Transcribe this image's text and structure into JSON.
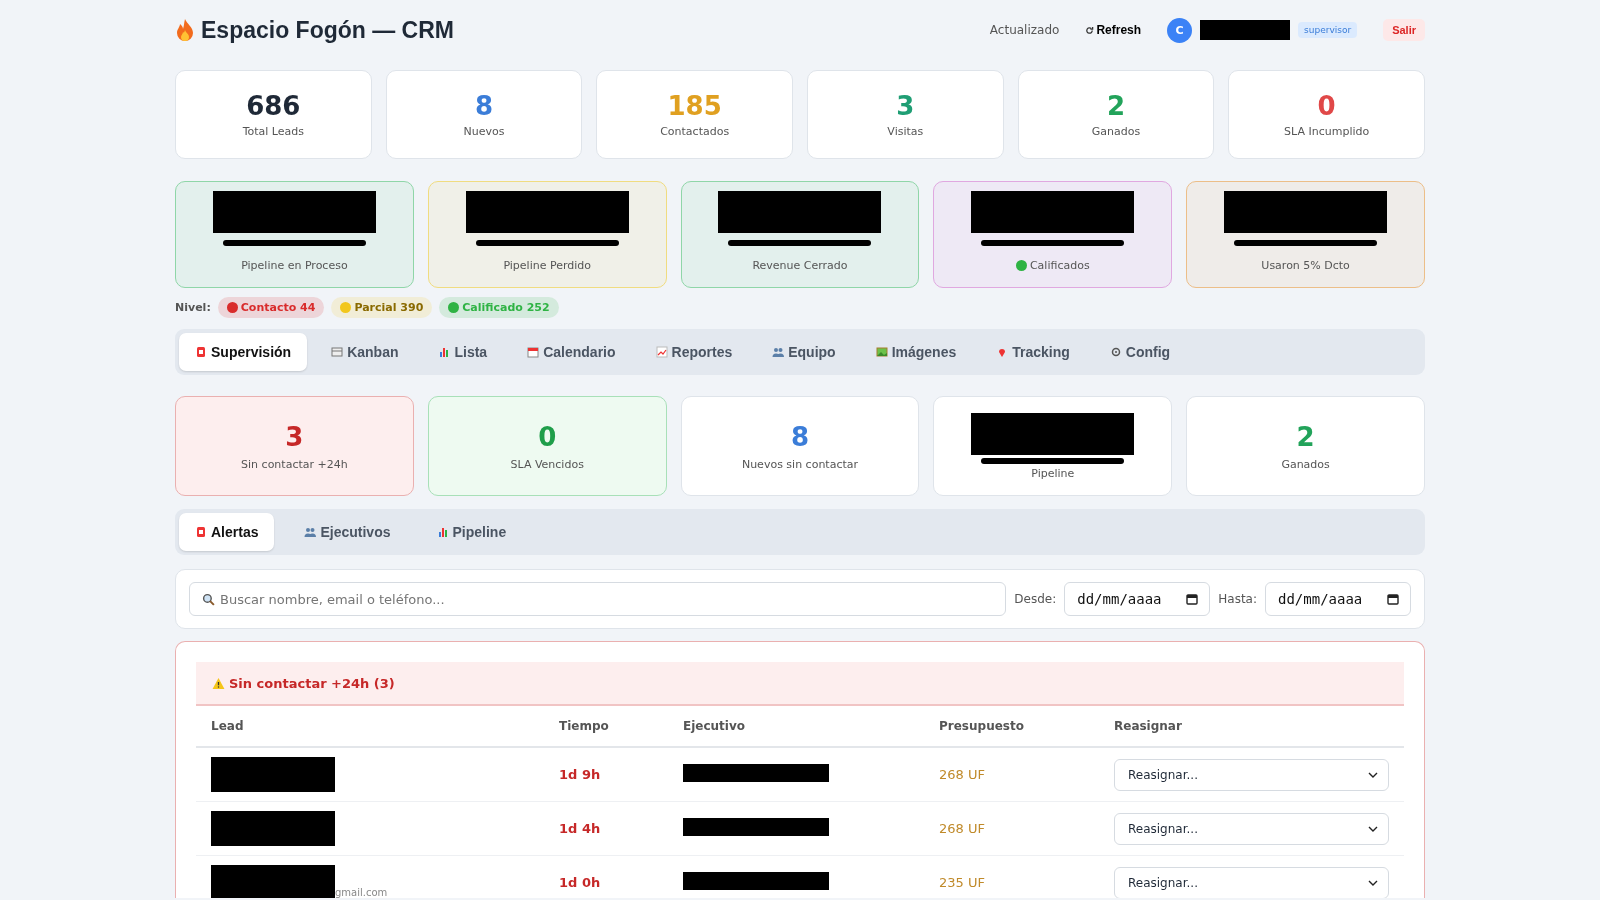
{
  "header": {
    "title": "Espacio Fogón — CRM",
    "updated": "Actualizado",
    "refresh": "Refresh",
    "avatar": "C",
    "role": "supervisor",
    "logout": "Salir"
  },
  "stats": [
    {
      "value": "686",
      "label": "Total Leads",
      "color": "#1f2937"
    },
    {
      "value": "8",
      "label": "Nuevos",
      "color": "#3b7dd8"
    },
    {
      "value": "185",
      "label": "Contactados",
      "color": "#e0a020"
    },
    {
      "value": "3",
      "label": "Visitas",
      "color": "#1f9e74"
    },
    {
      "value": "2",
      "label": "Ganados",
      "color": "#22a35a"
    },
    {
      "value": "0",
      "label": "SLA Incumplido",
      "color": "#e04848"
    }
  ],
  "kpis": [
    {
      "label": "Pipeline en Proceso",
      "color": "#8fd6a8",
      "dot": false
    },
    {
      "label": "Pipeline Perdido",
      "color": "#f0dc80",
      "dot": false
    },
    {
      "label": "Revenue Cerrado",
      "color": "#8fd6a8",
      "dot": false
    },
    {
      "label": "Calificados",
      "color": "#e0a8e0",
      "dot": true
    },
    {
      "label": "Usaron 5% Dcto",
      "color": "#ecbe88",
      "dot": false
    }
  ],
  "levels": {
    "label": "Nivel:",
    "items": [
      {
        "text": "Contacto 44",
        "color": "#d92b2b"
      },
      {
        "text": "Parcial 390",
        "color": "#f2c71c"
      },
      {
        "text": "Calificado 252",
        "color": "#2fb344"
      }
    ]
  },
  "tabs": [
    {
      "label": "Supervisión",
      "selected": true
    },
    {
      "label": "Kanban",
      "selected": false
    },
    {
      "label": "Lista",
      "selected": false
    },
    {
      "label": "Calendario",
      "selected": false
    },
    {
      "label": "Reportes",
      "selected": false
    },
    {
      "label": "Equipo",
      "selected": false
    },
    {
      "label": "Imágenes",
      "selected": false
    },
    {
      "label": "Tracking",
      "selected": false
    },
    {
      "label": "Config",
      "selected": false
    }
  ],
  "supervision_cards": [
    {
      "kind": "alert",
      "value": "3",
      "label": "Sin contactar +24h"
    },
    {
      "kind": "ok",
      "value": "0",
      "label": "SLA Vencidos"
    },
    {
      "kind": "info",
      "value": "8",
      "label": "Nuevos sin contactar"
    },
    {
      "kind": "redacted",
      "label": "Pipeline"
    },
    {
      "kind": "won",
      "value": "2",
      "label": "Ganados"
    }
  ],
  "subtabs": [
    {
      "label": "Alertas",
      "selected": true
    },
    {
      "label": "Ejecutivos",
      "selected": false
    },
    {
      "label": "Pipeline",
      "selected": false
    }
  ],
  "filters": {
    "search_placeholder": "Buscar nombre, email o teléfono...",
    "from_label": "Desde:",
    "from_placeholder": "dd/mm/aaaa",
    "to_label": "Hasta:",
    "to_placeholder": "dd/mm/aaaa"
  },
  "alert_table": {
    "title": "Sin contactar +24h (3)",
    "columns": [
      "Lead",
      "Tiempo",
      "Ejecutivo",
      "Presupuesto",
      "Reasignar"
    ],
    "rows": [
      {
        "time": "1d 9h",
        "budget": "268 UF",
        "reassign": "Reasignar..."
      },
      {
        "time": "1d 4h",
        "budget": "268 UF",
        "reassign": "Reasignar..."
      },
      {
        "time": "1d 0h",
        "budget": "235 UF",
        "reassign": "Reasignar...",
        "lead_fragment": "gmail.com"
      }
    ]
  }
}
